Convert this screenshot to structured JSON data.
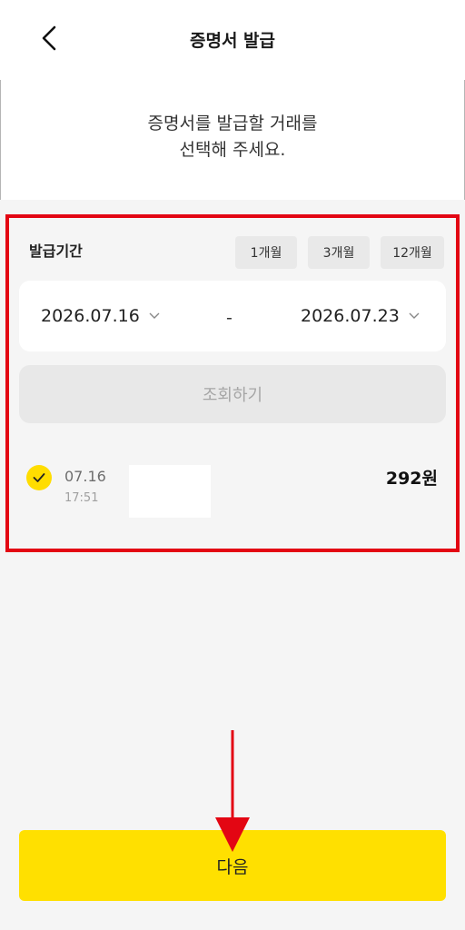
{
  "header": {
    "title": "증명서 발급"
  },
  "instruction": {
    "line1": "증명서를 발급할 거래를",
    "line2": "선택해 주세요."
  },
  "period": {
    "label": "발급기간",
    "chips": [
      "1개월",
      "3개월",
      "12개월"
    ],
    "start_date": "2026.07.16",
    "separator": "-",
    "end_date": "2026.07.23"
  },
  "query_button": "조회하기",
  "transactions": [
    {
      "date": "07.16",
      "time": "17:51",
      "amount": "292원",
      "selected": true
    }
  ],
  "next_button": "다음",
  "colors": {
    "accent": "#ffe000",
    "highlight": "#e30613",
    "background": "#f5f5f5"
  },
  "icons": {
    "back": "chevron-left-icon",
    "dropdown": "chevron-down-icon",
    "check": "check-icon",
    "annotation": "down-arrow-icon"
  }
}
